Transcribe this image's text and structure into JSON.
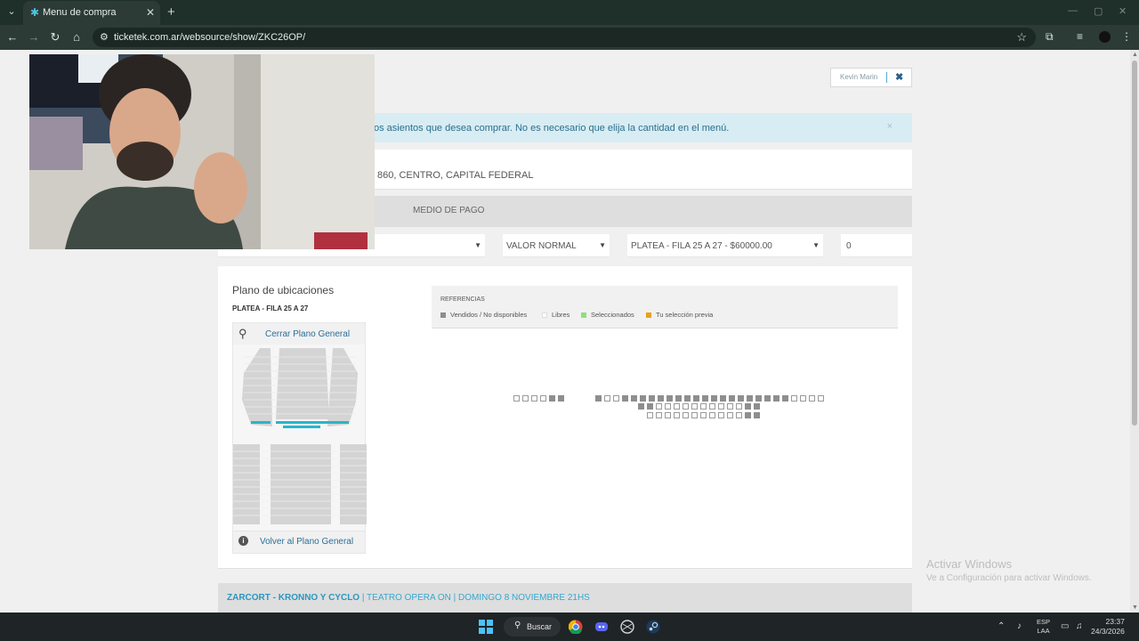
{
  "browser": {
    "tab_title": "Menu de compra",
    "url": "ticketek.com.ar/websource/show/ZKC26OP/"
  },
  "user": {
    "name": "Kevin Marin",
    "close_glyph": "✖"
  },
  "info": {
    "message": "os asientos que desea comprar. No es necesario que elija la cantidad en el menú.",
    "close_glyph": "×"
  },
  "venue": {
    "address_fragment": "860, CENTRO, CAPITAL FEDERAL"
  },
  "steps": {
    "payment_label": "MEDIO DE PAGO"
  },
  "selectors": {
    "price_type": "VALOR NORMAL",
    "section": "PLATEA - FILA 25 A 27 - $60000.00",
    "quantity": "0"
  },
  "plano": {
    "title": "Plano de ubicaciones",
    "subtitle": "PLATEA - FILA 25 A 27",
    "close_link": "Cerrar Plano General",
    "back_link": "Volver al Plano General"
  },
  "references": {
    "title": "REFERENCIAS",
    "items": [
      {
        "label": "Vendidos / No disponibles",
        "color": "#8e8e8e"
      },
      {
        "label": "Libres",
        "color": "#ffffff"
      },
      {
        "label": "Seleccionados",
        "color": "#8ee07a"
      },
      {
        "label": "Tu selección previa",
        "color": "#e8a317"
      }
    ]
  },
  "footer": {
    "artist": "ZARCORT - KRONNO Y CYCLO",
    "details": " | TEATRO OPERA ON | DOMINGO 8 NOVIEMBRE 21HS"
  },
  "windows_watermark": {
    "title": "Activar Windows",
    "subtitle": "Ve a Configuración para activar Windows."
  },
  "taskbar": {
    "search_label": "Buscar",
    "lang_line1": "ESP",
    "lang_line2": "LAA",
    "time": "23:37",
    "date": "24/3/2026"
  },
  "colors": {
    "accent_link": "#2a6f9a",
    "footer_accent": "#34a8d0",
    "info_bg": "#d8ecf3"
  }
}
